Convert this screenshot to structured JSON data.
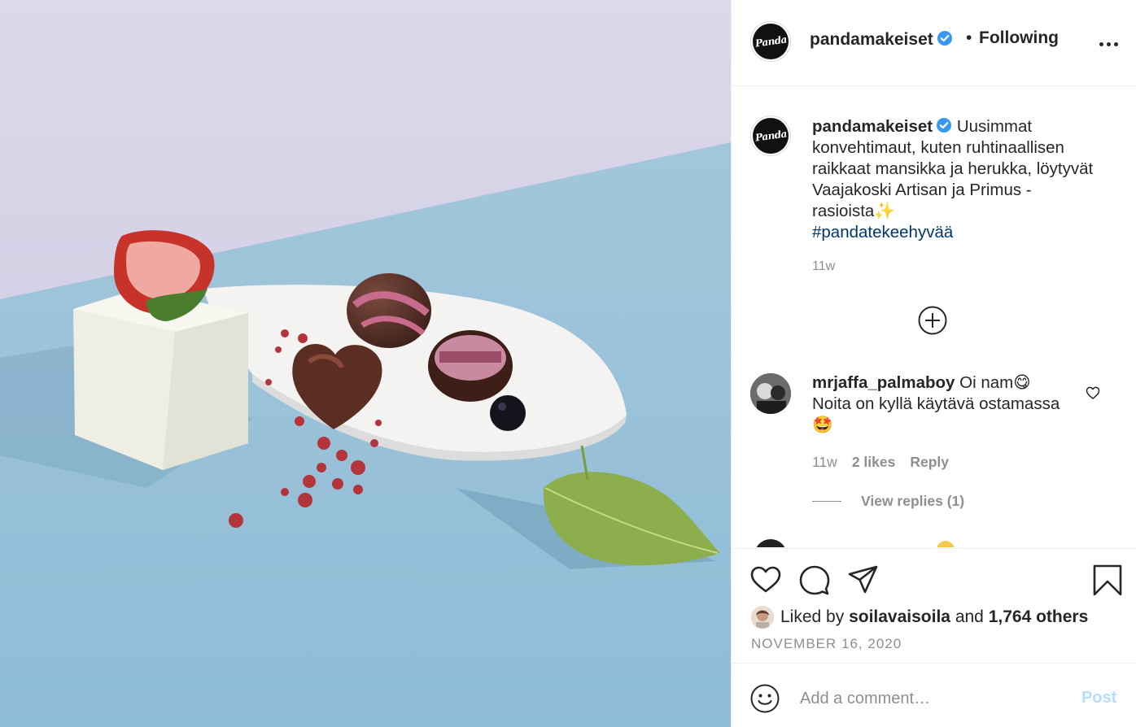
{
  "post": {
    "username": "pandamakeiset",
    "logo_text": "Panda",
    "separator": "•",
    "follow_status": "Following",
    "caption_text": "Uusimmat konvehtimaut, kuten ruhtinaallisen raikkaat mansikka ja herukka, löytyvät Vaajakoski Artisan ja Primus -rasioista✨",
    "hashtag": "#pandatekeehyvää",
    "caption_time": "11w"
  },
  "comment": {
    "username": "mrjaffa_palmaboy",
    "text": "Oi nam😋 Noita on kyllä käytävä ostamassa🤩",
    "time": "11w",
    "likes": "2 likes",
    "reply_label": "Reply",
    "view_replies": "View replies (1)"
  },
  "likes": {
    "prefix": "Liked by",
    "user": "soilavaisoila",
    "and": "and",
    "others": "1,764 others"
  },
  "date": "NOVEMBER 16, 2020",
  "comment_box": {
    "placeholder": "Add a comment…",
    "post_label": "Post"
  },
  "icons": {
    "verified": "verified-badge-icon",
    "more": "more-options-icon",
    "load_more": "plus-circle-icon",
    "like": "heart-icon",
    "comment": "comment-bubble-icon",
    "share": "paper-plane-icon",
    "save": "bookmark-icon",
    "emoji": "smiley-icon"
  },
  "colors": {
    "verified_blue": "#3897f0",
    "hashtag": "#00376b",
    "secondary_text": "#8e8e8e",
    "post_disabled": "#b2dffc"
  }
}
